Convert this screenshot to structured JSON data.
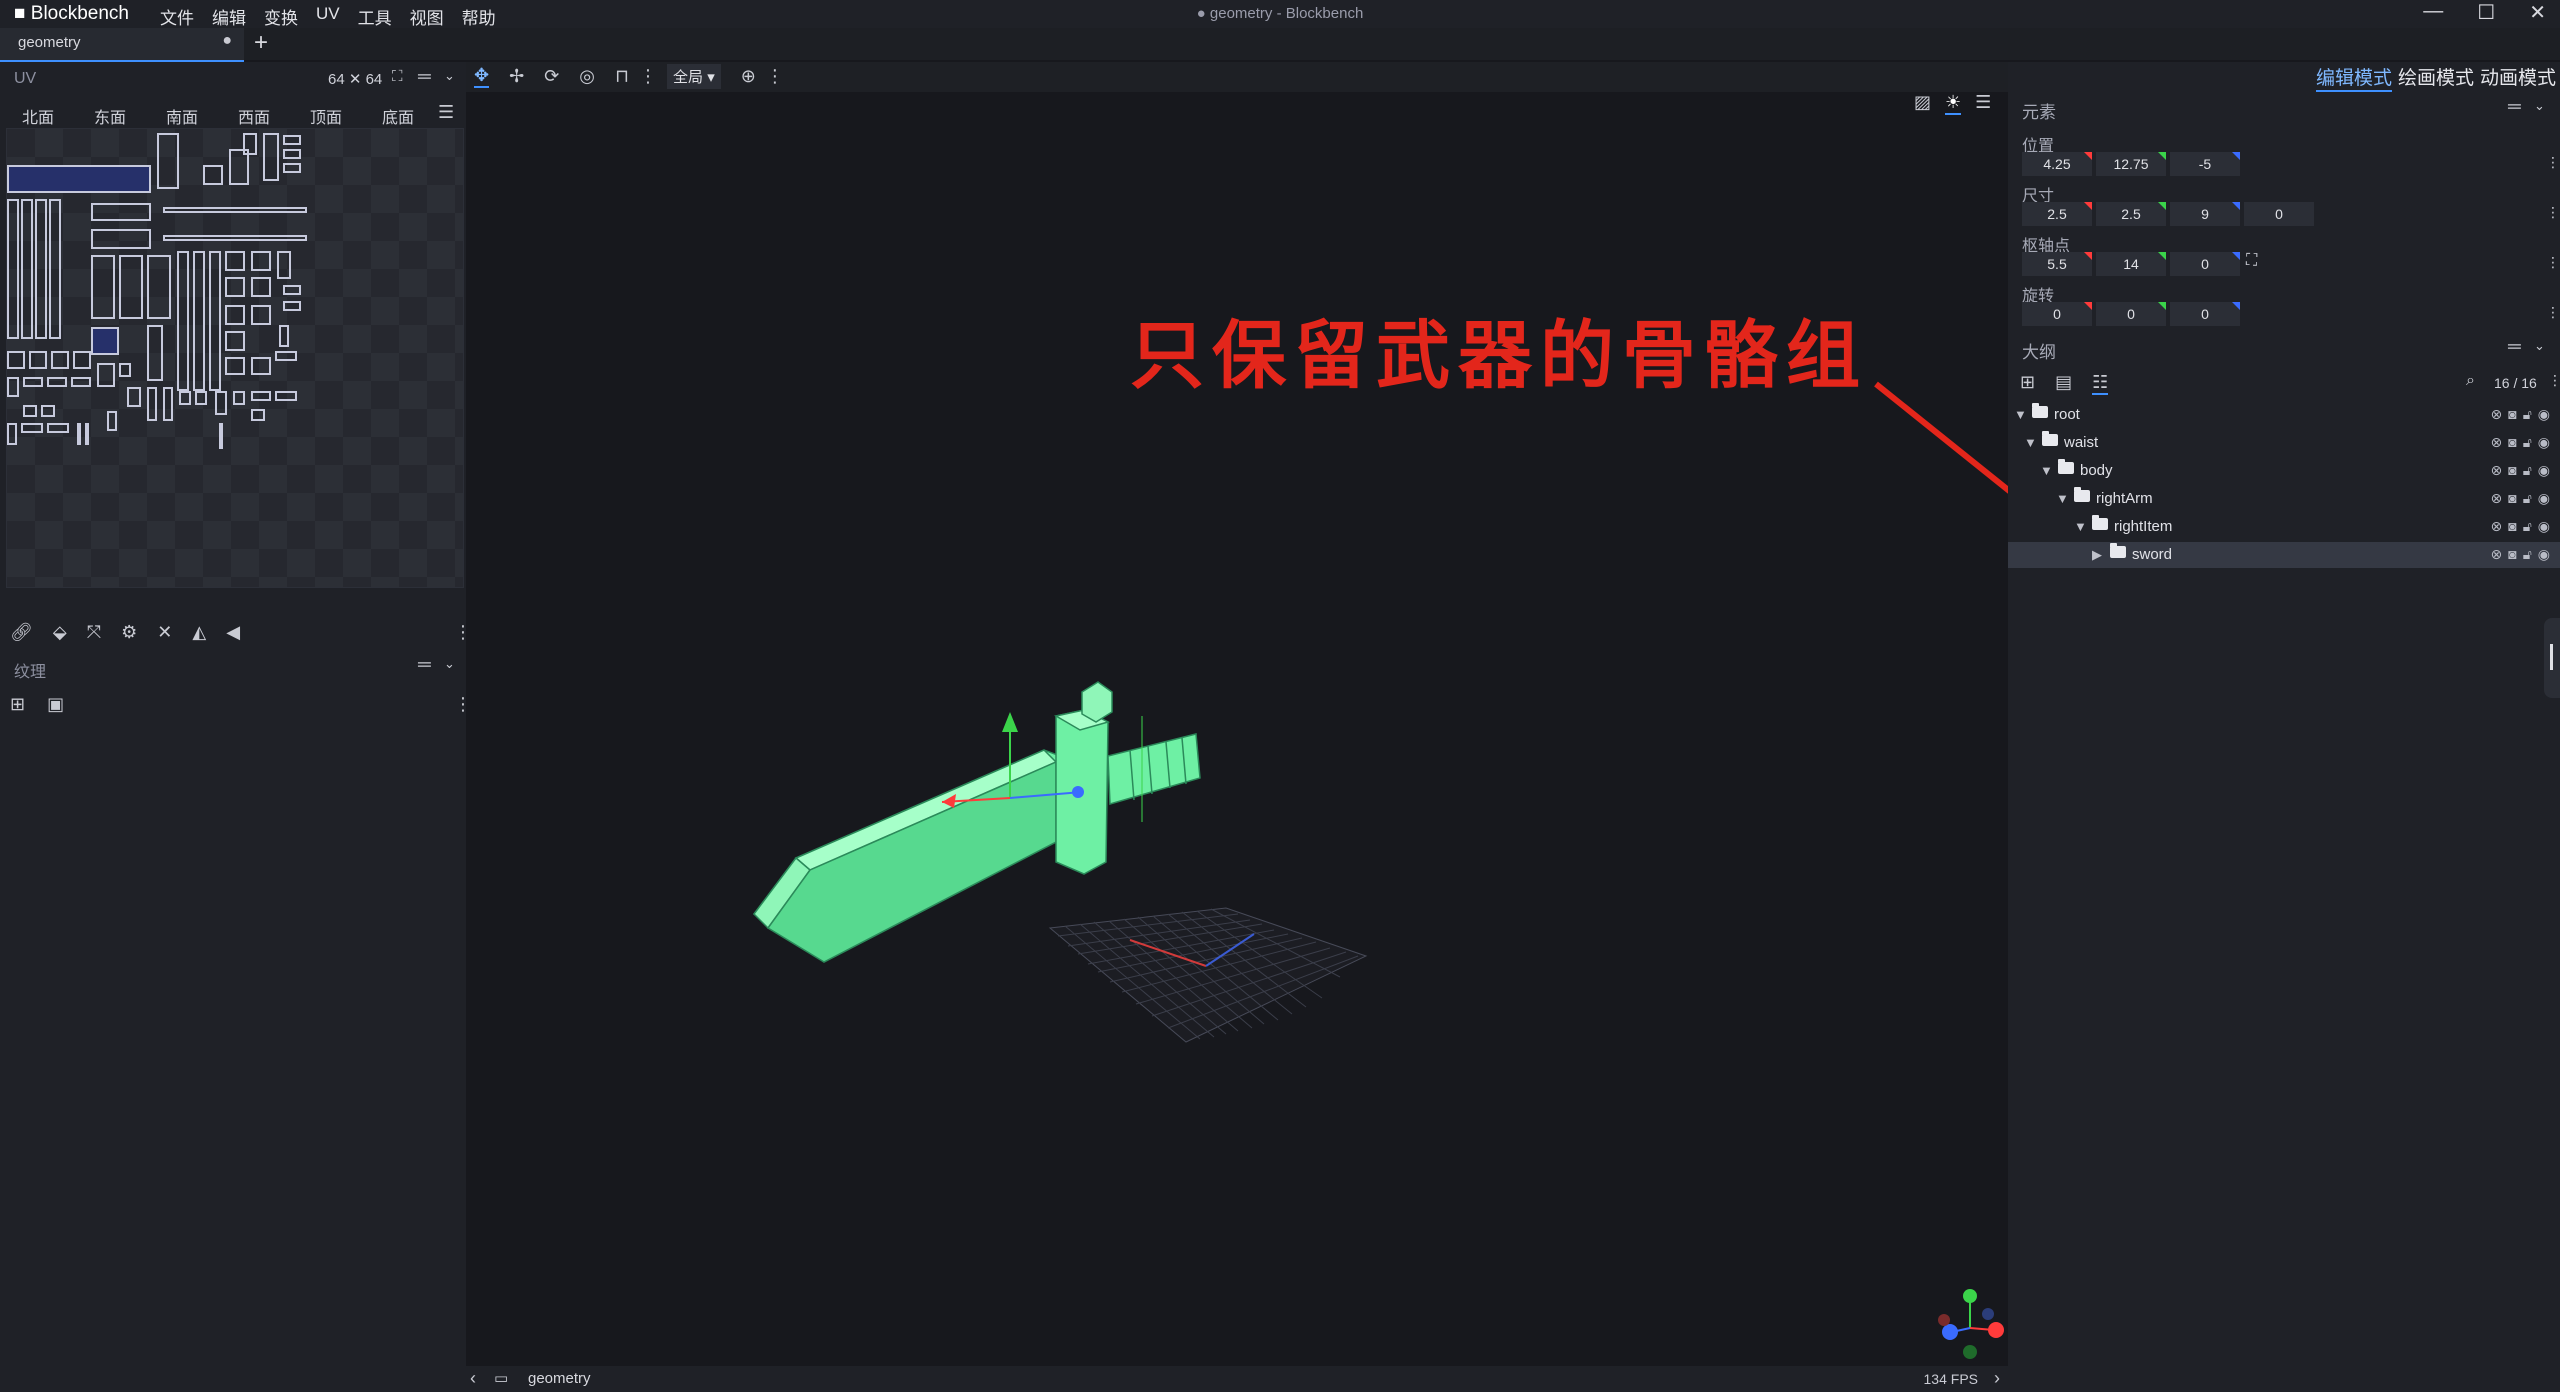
{
  "titlebar": {
    "app_name": "Blockbench",
    "menu": [
      "文件",
      "编辑",
      "变换",
      "UV",
      "工具",
      "视图",
      "帮助"
    ],
    "window_title": "● geometry - Blockbench",
    "minimize": "—",
    "maximize": "☐",
    "close": "✕"
  },
  "tabs": [
    {
      "label": "geometry",
      "unsaved_marker": "●"
    }
  ],
  "new_tab": "+",
  "uv_panel": {
    "title": "UV",
    "size": "64 ✕ 64",
    "faces": [
      "北面",
      "东面",
      "南面",
      "西面",
      "顶面",
      "底面"
    ]
  },
  "texture_panel": {
    "title": "纹理"
  },
  "viewport": {
    "scope_select": "全局",
    "status_model": "geometry",
    "fps": "134 FPS"
  },
  "modes": [
    "编辑模式",
    "绘画模式",
    "动画模式"
  ],
  "element_panel": {
    "title": "元素",
    "position": {
      "label": "位置",
      "values": [
        "4.25",
        "12.75",
        "-5"
      ]
    },
    "size": {
      "label": "尺寸",
      "values": [
        "2.5",
        "2.5",
        "9",
        "0"
      ]
    },
    "pivot": {
      "label": "枢轴点",
      "values": [
        "5.5",
        "14",
        "0"
      ]
    },
    "rotation": {
      "label": "旋转",
      "values": [
        "0",
        "0",
        "0"
      ]
    }
  },
  "outliner": {
    "title": "大纲",
    "count": "16 / 16",
    "items": [
      {
        "name": "root"
      },
      {
        "name": "waist"
      },
      {
        "name": "body"
      },
      {
        "name": "rightArm"
      },
      {
        "name": "rightItem"
      },
      {
        "name": "sword",
        "selected": true
      }
    ]
  },
  "annotation": {
    "text": "只保留武器的骨骼组",
    "color": "#e3261b"
  },
  "colors": {
    "accent": "#3e90ff",
    "model_green": "#6ef0a4",
    "axis_x": "#ff3b3b",
    "axis_y": "#3bd44a",
    "axis_z": "#3a6bff"
  }
}
